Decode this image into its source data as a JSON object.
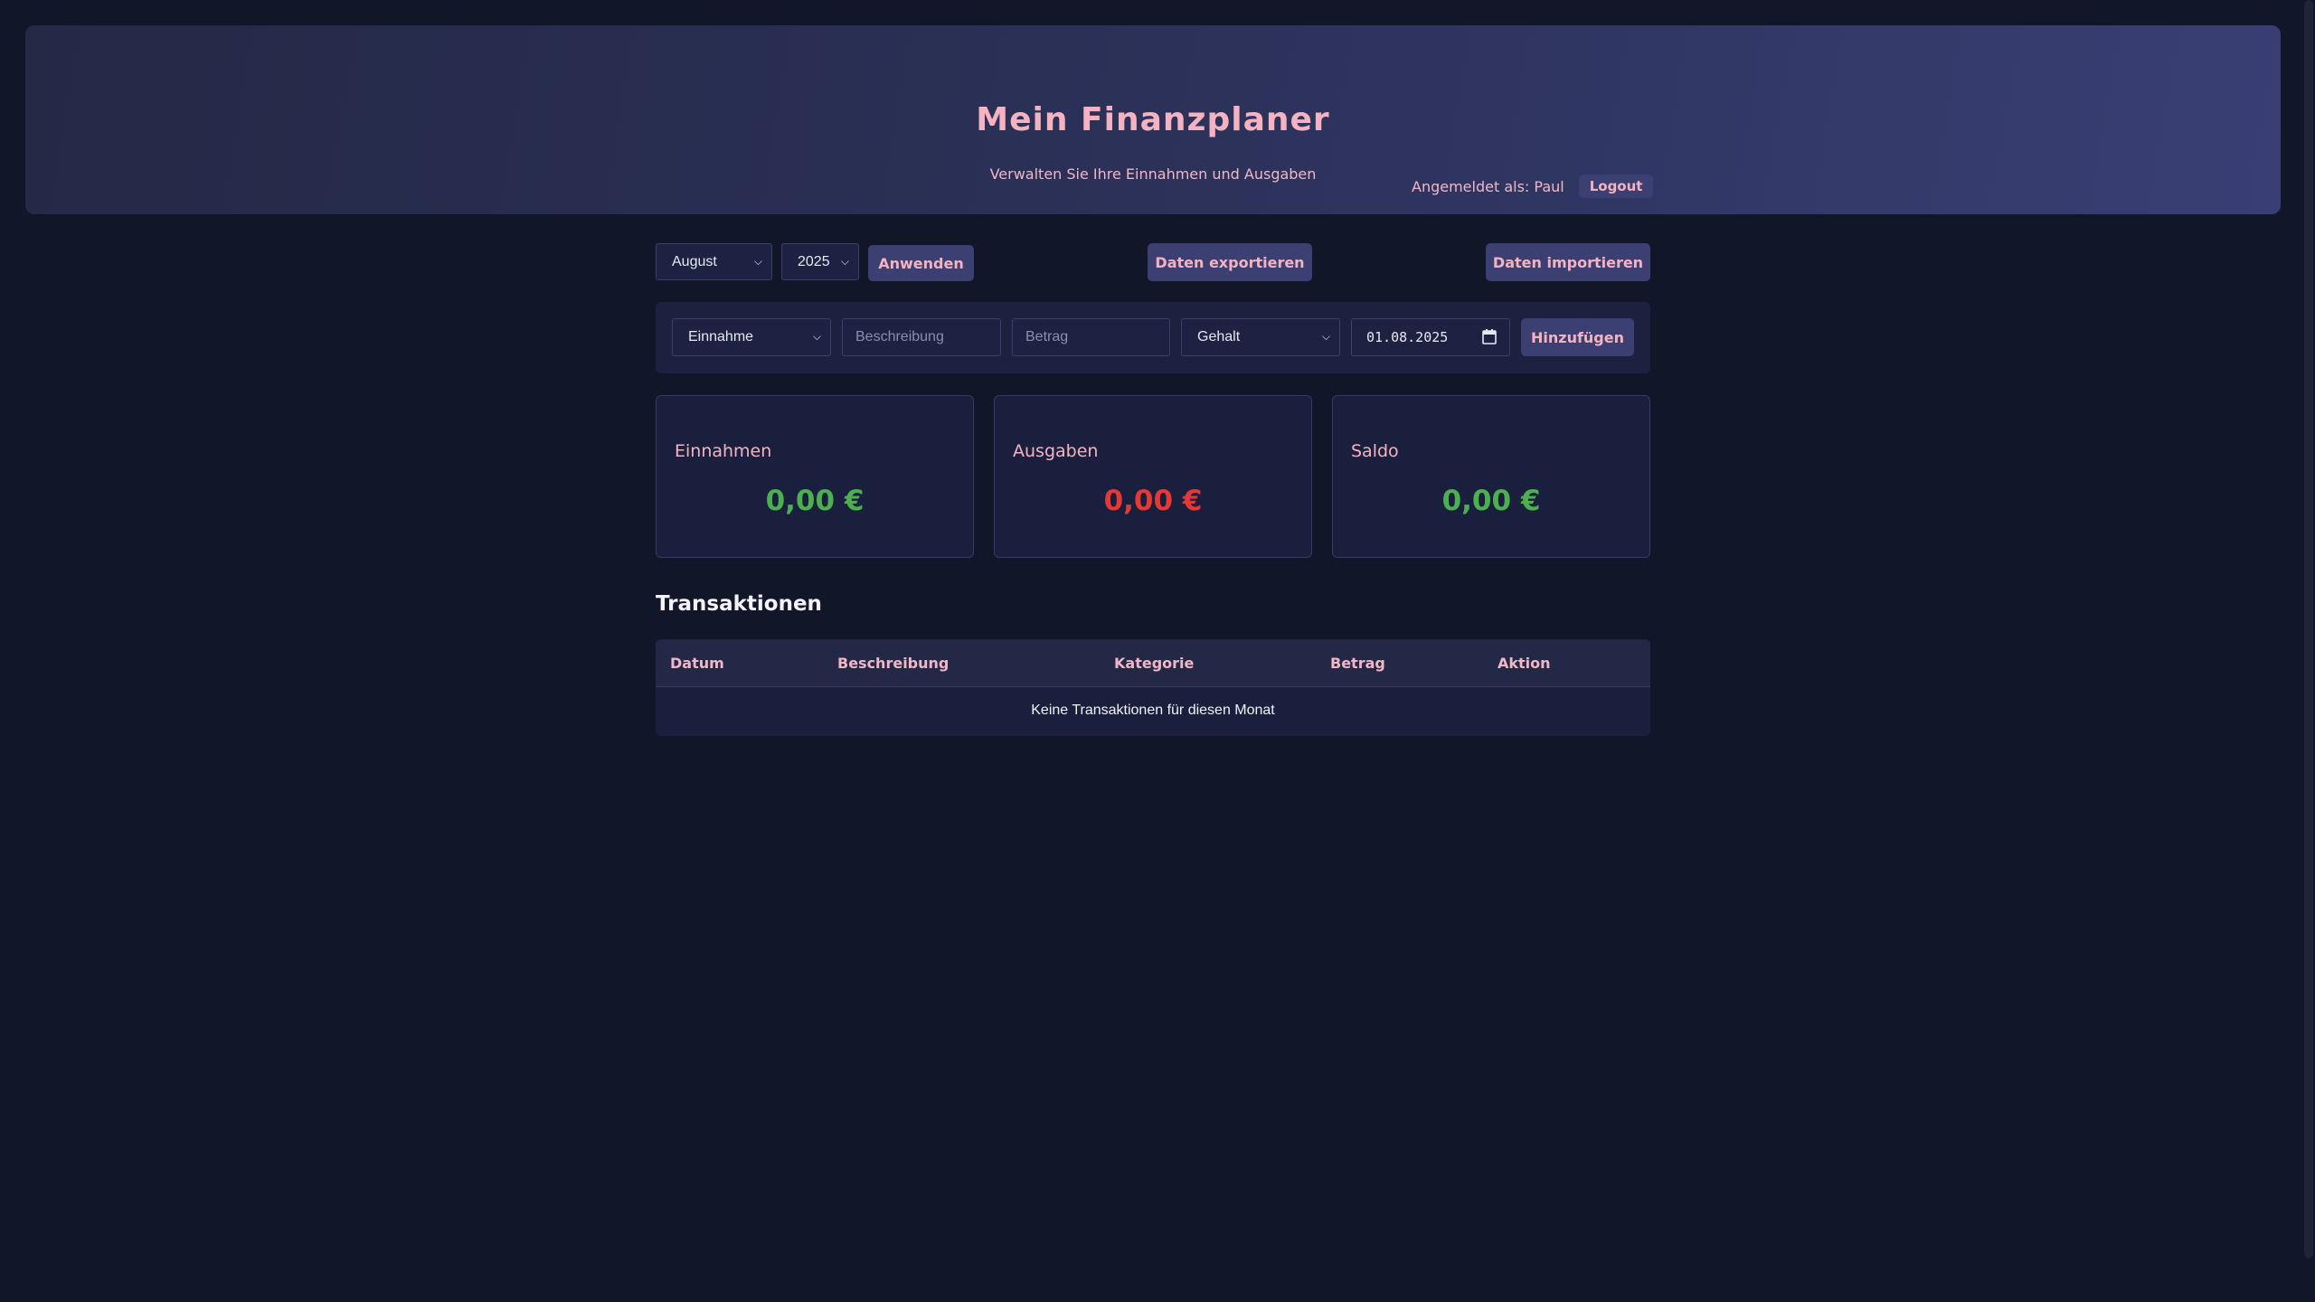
{
  "header": {
    "title": "Mein Finanzplaner",
    "subtitle": "Verwalten Sie Ihre Einnahmen und Ausgaben",
    "logged_in_as": "Angemeldet als: Paul",
    "logout_label": "Logout"
  },
  "filter": {
    "month": "August",
    "year": "2025",
    "apply_label": "Anwenden",
    "export_label": "Daten exportieren",
    "import_label": "Daten importieren"
  },
  "add_form": {
    "type": "Einnahme",
    "description_placeholder": "Beschreibung",
    "amount_placeholder": "Betrag",
    "category": "Gehalt",
    "date": "01.08.2025",
    "add_label": "Hinzufügen"
  },
  "summary": {
    "income_label": "Einnahmen",
    "income_value": "0,00 €",
    "expense_label": "Ausgaben",
    "expense_value": "0,00 €",
    "balance_label": "Saldo",
    "balance_value": "0,00 €"
  },
  "colors": {
    "accent_pink": "#f5b3c2",
    "positive": "#4caf50",
    "negative": "#e53935",
    "button_bg": "#3b3f72"
  },
  "transactions": {
    "title": "Transaktionen",
    "columns": [
      "Datum",
      "Beschreibung",
      "Kategorie",
      "Betrag",
      "Aktion"
    ],
    "empty_text": "Keine Transaktionen für diesen Monat"
  }
}
